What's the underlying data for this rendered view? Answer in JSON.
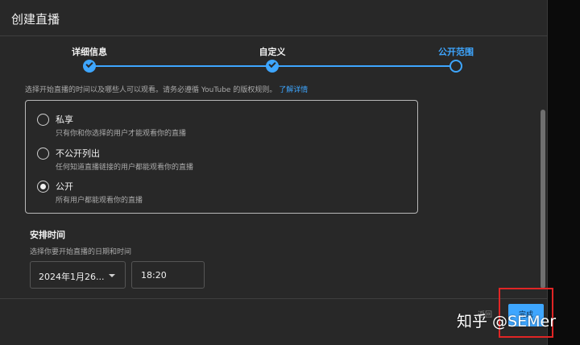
{
  "dialog": {
    "title": "创建直播"
  },
  "stepper": {
    "steps": [
      {
        "label": "详细信息",
        "state": "done"
      },
      {
        "label": "自定义",
        "state": "done"
      },
      {
        "label": "公开范围",
        "state": "current"
      }
    ]
  },
  "visibility": {
    "description": "选择开始直播的时间以及哪些人可以观看。请务必遵循 YouTube 的版权规则。",
    "learn_more": "了解详情",
    "options": [
      {
        "title": "私享",
        "subtitle": "只有你和你选择的用户才能观看你的直播",
        "checked": false
      },
      {
        "title": "不公开列出",
        "subtitle": "任何知道直播链接的用户都能观看你的直播",
        "checked": false
      },
      {
        "title": "公开",
        "subtitle": "所有用户都能观看你的直播",
        "checked": true
      }
    ]
  },
  "schedule": {
    "title": "安排时间",
    "subtitle": "选择你要开始直播的日期和时间",
    "date_value": "2024年1月26...",
    "time_value": "18:20"
  },
  "footer": {
    "back_label": "返回",
    "done_label": "完成"
  },
  "watermark": "知乎 @SEMer",
  "colors": {
    "accent": "#3ea6ff",
    "dialog_bg": "#282828",
    "highlight": "#e02525"
  }
}
